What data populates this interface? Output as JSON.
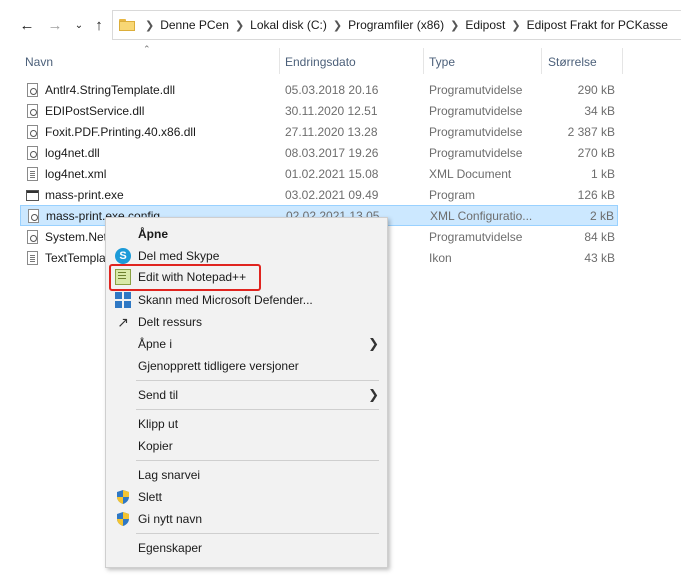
{
  "breadcrumb": [
    "Denne PCen",
    "Lokal disk (C:)",
    "Programfiler (x86)",
    "Edipost",
    "Edipost Frakt for PCKasse"
  ],
  "columns": {
    "name": "Navn",
    "date": "Endringsdato",
    "type": "Type",
    "size": "Størrelse"
  },
  "files": [
    {
      "name": "Antlr4.StringTemplate.dll",
      "date": "05.03.2018 20.16",
      "type": "Programutvidelse",
      "size": "290 kB",
      "icon": "dll-icon"
    },
    {
      "name": "EDIPostService.dll",
      "date": "30.11.2020 12.51",
      "type": "Programutvidelse",
      "size": "34 kB",
      "icon": "dll-icon"
    },
    {
      "name": "Foxit.PDF.Printing.40.x86.dll",
      "date": "27.11.2020 13.28",
      "type": "Programutvidelse",
      "size": "2 387 kB",
      "icon": "dll-icon"
    },
    {
      "name": "log4net.dll",
      "date": "08.03.2017 19.26",
      "type": "Programutvidelse",
      "size": "270 kB",
      "icon": "dll-icon"
    },
    {
      "name": "log4net.xml",
      "date": "01.02.2021 15.08",
      "type": "XML Document",
      "size": "1 kB",
      "icon": "xml-icon"
    },
    {
      "name": "mass-print.exe",
      "date": "03.02.2021 09.49",
      "type": "Program",
      "size": "126 kB",
      "icon": "exe-icon"
    },
    {
      "name": "mass-print.exe.config",
      "date": "02.02.2021 13.05",
      "type": "XML Configuratio...",
      "size": "2 kB",
      "icon": "config-icon",
      "selected": true
    },
    {
      "name": "System.Net",
      "date": "",
      "type": "Programutvidelse",
      "size": "84 kB",
      "icon": "dll-icon"
    },
    {
      "name": "TextTemplat",
      "date": "",
      "type": "Ikon",
      "size": "43 kB",
      "icon": "file-icon"
    }
  ],
  "context_menu": {
    "open": "Åpne",
    "share_skype": "Del med Skype",
    "edit_notepad": "Edit with Notepad++",
    "scan_defender": "Skann med Microsoft Defender...",
    "shared_resource": "Delt ressurs",
    "open_with": "Åpne i",
    "restore_versions": "Gjenopprett tidligere versjoner",
    "send_to": "Send til",
    "cut": "Klipp ut",
    "copy": "Kopier",
    "create_shortcut": "Lag snarvei",
    "delete": "Slett",
    "rename": "Gi nytt navn",
    "properties": "Egenskaper"
  },
  "colors": {
    "selection": "#cce8ff",
    "highlight_border": "#e0241f",
    "skype": "#1c9bd8"
  }
}
